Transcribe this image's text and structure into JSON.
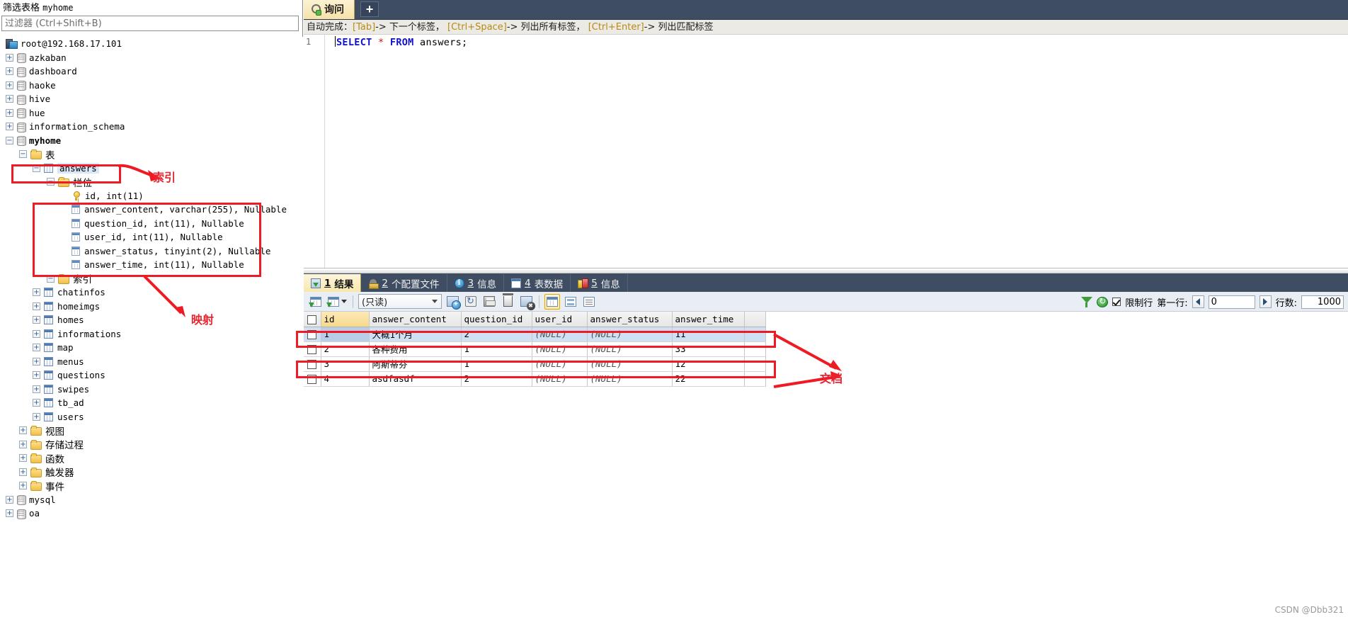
{
  "left_panel": {
    "filter_title_prefix": "筛选表格",
    "filter_title_db": "myhome",
    "filter_placeholder": "过滤器 (Ctrl+Shift+B)",
    "root": "root@192.168.17.101",
    "databases": [
      "azkaban",
      "dashboard",
      "haoke",
      "hive",
      "hue",
      "information_schema"
    ],
    "active_db": "myhome",
    "folder_tables": "表",
    "expanded_table": "answers",
    "folder_columns": "栏位",
    "columns": [
      "id, int(11)",
      "answer_content, varchar(255), Nullable",
      "question_id, int(11), Nullable",
      "user_id, int(11), Nullable",
      "answer_status, tinyint(2), Nullable",
      "answer_time, int(11), Nullable"
    ],
    "folder_indexes": "索引",
    "other_tables": [
      "chatinfos",
      "homeimgs",
      "homes",
      "informations",
      "map",
      "menus",
      "questions",
      "swipes",
      "tb_ad",
      "users"
    ],
    "db_folders": [
      "视图",
      "存储过程",
      "函数",
      "触发器",
      "事件"
    ],
    "trailing_databases": [
      "mysql",
      "oa"
    ]
  },
  "annotations": {
    "index_label": "索引",
    "mapping_label": "映射",
    "document_label": "文档"
  },
  "query": {
    "tab_label": "询问",
    "add_tab_label": "+",
    "hint_prefix": "自动完成：",
    "hint_k1": "[Tab]",
    "hint_t1": "-> 下一个标签，",
    "hint_k2": "[Ctrl+Space]",
    "hint_t2": "-> 列出所有标签，",
    "hint_k3": "[Ctrl+Enter]",
    "hint_t3": "-> 列出匹配标签",
    "line_number": "1",
    "sql_keyword1": "SELECT",
    "sql_star": "*",
    "sql_keyword2": "FROM",
    "sql_table": "answers;"
  },
  "results": {
    "tabs": [
      {
        "num": "1",
        "label": "结果",
        "icon": "result-icon",
        "active": true
      },
      {
        "num": "2",
        "label": "个配置文件",
        "icon": "profile-icon",
        "active": false
      },
      {
        "num": "3",
        "label": "信息",
        "icon": "info-icon",
        "active": false
      },
      {
        "num": "4",
        "label": "表数据",
        "icon": "table-data-icon",
        "active": false
      },
      {
        "num": "5",
        "label": "信息",
        "icon": "info2-icon",
        "active": false
      }
    ],
    "readonly_value": "(只读)",
    "limit_label": "限制行",
    "first_row_label": "第一行:",
    "first_row_value": "0",
    "rows_label": "行数:",
    "rows_value": "1000",
    "columns": [
      "id",
      "answer_content",
      "question_id",
      "user_id",
      "answer_status",
      "answer_time"
    ],
    "rows": [
      {
        "id": "1",
        "answer_content": "大概1个月",
        "question_id": "2",
        "user_id": "(NULL)",
        "answer_status": "(NULL)",
        "answer_time": "11",
        "selected": true
      },
      {
        "id": "2",
        "answer_content": "各种费用",
        "question_id": "1",
        "user_id": "(NULL)",
        "answer_status": "(NULL)",
        "answer_time": "33",
        "selected": false
      },
      {
        "id": "3",
        "answer_content": "阿斯蒂芬",
        "question_id": "1",
        "user_id": "(NULL)",
        "answer_status": "(NULL)",
        "answer_time": "12",
        "selected": false
      },
      {
        "id": "4",
        "answer_content": "asdfasdf",
        "question_id": "2",
        "user_id": "(NULL)",
        "answer_status": "(NULL)",
        "answer_time": "22",
        "selected": false
      }
    ]
  },
  "watermark": "CSDN @Dbb321",
  "colors": {
    "annotation_red": "#ee1b24",
    "tab_bar_dark": "#3f4d63",
    "active_tab_yellow": "#f7e7ae",
    "row_select_blue": "#cfe0f2"
  }
}
